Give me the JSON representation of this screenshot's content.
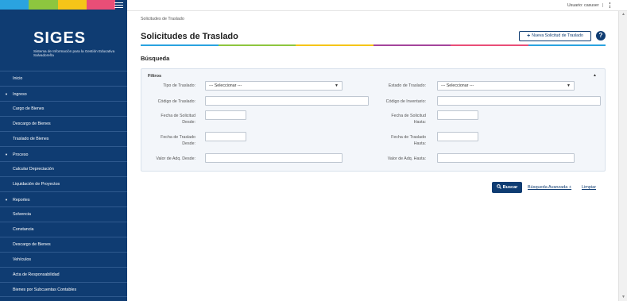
{
  "app": {
    "name": "SIGES",
    "subtitle": "Sistema de Información para la Gestión Educativa Salvadoreña"
  },
  "colors": {
    "sidebar": "#0f3c72",
    "accent": "#0f3c72",
    "band": [
      "#2aa3e0",
      "#8dc63f",
      "#f5c518",
      "#e94e77"
    ],
    "rainbow": [
      "#2aa3e0",
      "#8dc63f",
      "#f5c518",
      "#a4449b",
      "#e94e77",
      "#2aa3e0"
    ]
  },
  "icons": {
    "menu": "hamburger-icon",
    "more": "kebab-icon",
    "help": "help-icon",
    "add": "plus-icon",
    "search": "search-icon",
    "collapse": "caret-up-icon",
    "dropdown": "caret-down-icon"
  },
  "sidebar": {
    "items": [
      {
        "label": "Inicio",
        "type": "item"
      },
      {
        "label": "Ingreso",
        "type": "section"
      },
      {
        "label": "Cargo de Bienes",
        "type": "item"
      },
      {
        "label": "Descargo de Bienes",
        "type": "item"
      },
      {
        "label": "Traslado de Bienes",
        "type": "item"
      },
      {
        "label": "Proceso",
        "type": "section"
      },
      {
        "label": "Calcular Depreciación",
        "type": "item"
      },
      {
        "label": "Liquidación de Proyectos",
        "type": "item"
      },
      {
        "label": "Reportes",
        "type": "section"
      },
      {
        "label": "Solvencia",
        "type": "item"
      },
      {
        "label": "Constancia",
        "type": "item"
      },
      {
        "label": "Descargo de Bienes",
        "type": "item"
      },
      {
        "label": "Vehículos",
        "type": "item"
      },
      {
        "label": "Acta de Responsabilidad",
        "type": "item"
      },
      {
        "label": "Bienes por Subcuentas Contables",
        "type": "item"
      }
    ]
  },
  "topbar": {
    "user_label": "Usuario: casuser",
    "separator": "|"
  },
  "breadcrumb": "Solicitudes de Traslado",
  "page": {
    "title": "Solicitudes de Traslado",
    "new_button": "Nueva Solicitud de Traslado",
    "help": "?",
    "section_title": "Búsqueda"
  },
  "filters": {
    "title": "Filtros",
    "fields": {
      "tipo_traslado": {
        "label": "Tipo de Traslado:",
        "value": "--- Seleccionar ---"
      },
      "estado_traslado": {
        "label": "Estado de Traslado:",
        "value": "--- Seleccionar ---"
      },
      "codigo_traslado": {
        "label": "Código de Traslado:",
        "value": ""
      },
      "codigo_inventario": {
        "label": "Código de Inventario:",
        "value": ""
      },
      "fecha_solicitud_desde": {
        "label1": "Fecha de Solicitud",
        "label2": "Desde:",
        "value": ""
      },
      "fecha_solicitud_hasta": {
        "label1": "Fecha de Solicitud",
        "label2": "Hasta:",
        "value": ""
      },
      "fecha_traslado_desde": {
        "label1": "Fecha de Traslado",
        "label2": "Desde:",
        "value": ""
      },
      "fecha_traslado_hasta": {
        "label1": "Fecha de Traslado",
        "label2": "Hasta:",
        "value": ""
      },
      "valor_desde": {
        "label": "Valor de Adq. Desde:",
        "value": ""
      },
      "valor_hasta": {
        "label": "Valor de Adq. Hasta:",
        "value": ""
      }
    }
  },
  "actions": {
    "search": "Buscar",
    "advanced": "Búsqueda Avanzada +",
    "clear": "Limpiar"
  }
}
